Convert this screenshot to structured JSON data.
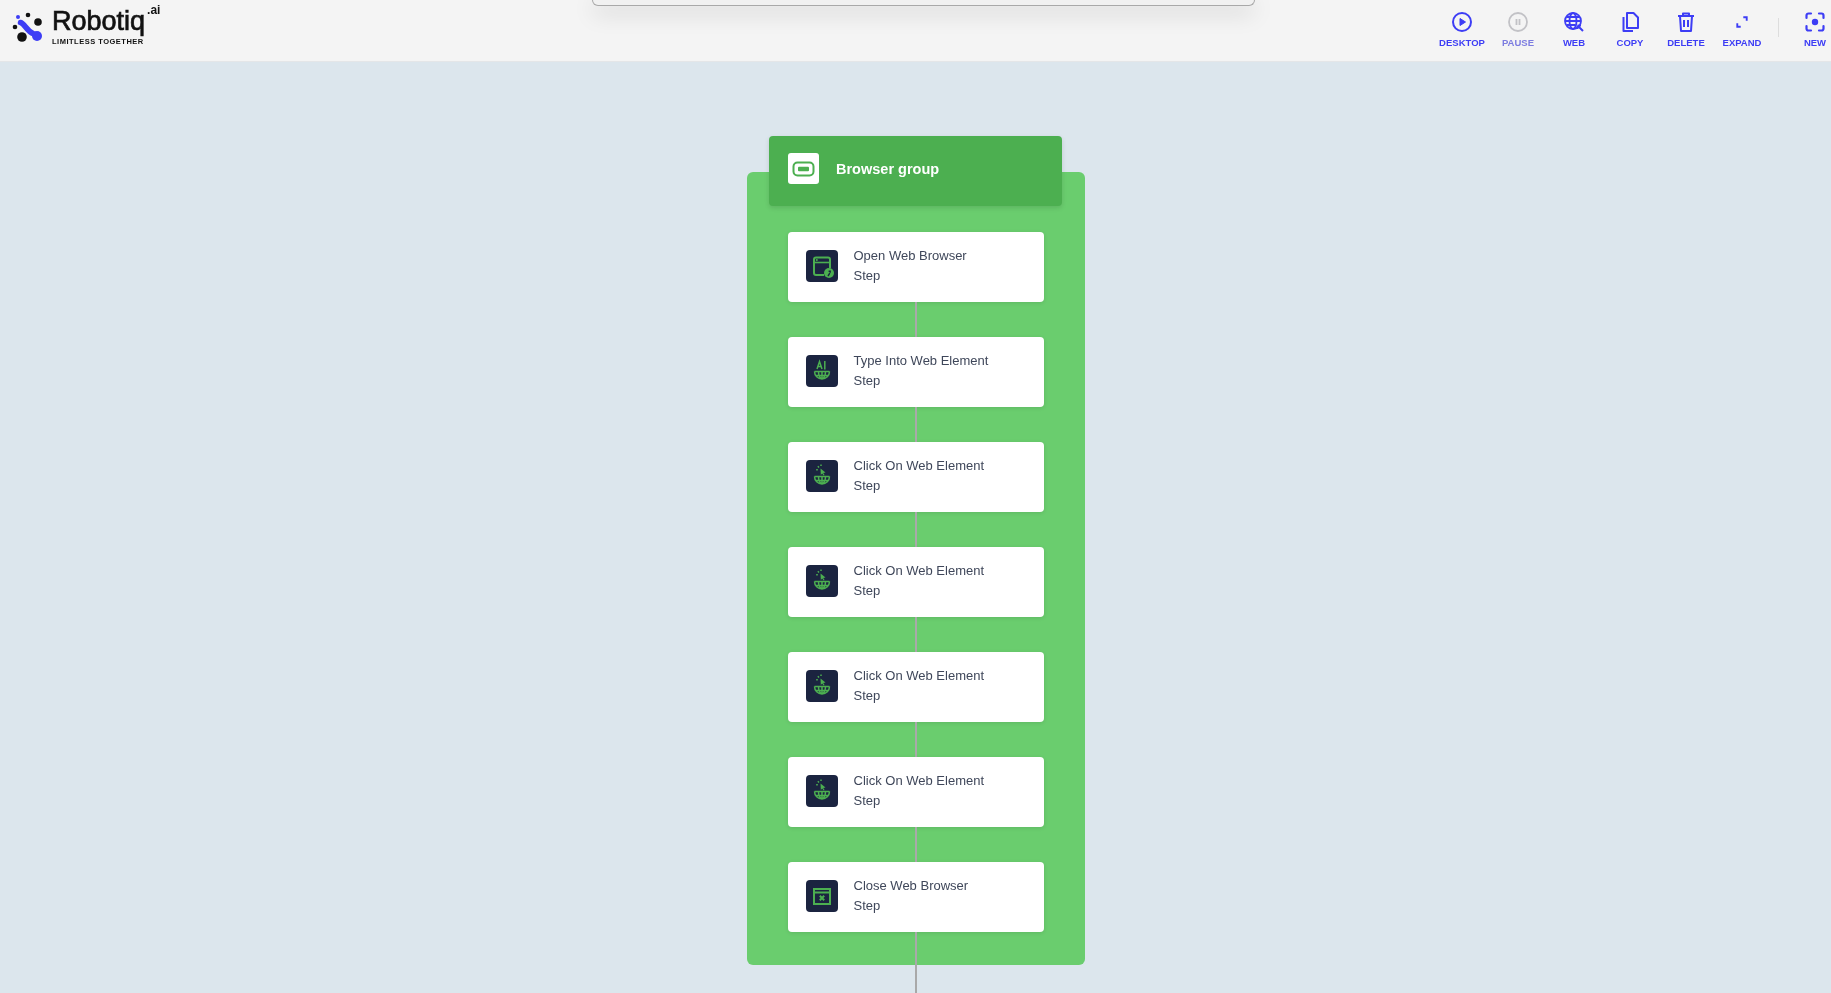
{
  "header": {
    "logo": {
      "wordmark": "Robotiq",
      "superscript": ".ai",
      "tagline": "LIMITLESS TOGETHER"
    },
    "toolbar": [
      {
        "label": "DESKTOP",
        "kind": "desktop",
        "disabled": false
      },
      {
        "label": "PAUSE",
        "kind": "pause",
        "disabled": true
      },
      {
        "label": "WEB",
        "kind": "web",
        "disabled": false
      },
      {
        "label": "COPY",
        "kind": "copy",
        "disabled": false
      },
      {
        "label": "DELETE",
        "kind": "delete",
        "disabled": false
      },
      {
        "label": "EXPAND",
        "kind": "expand",
        "disabled": false
      }
    ],
    "toolbar_end": [
      {
        "label": "NEW",
        "kind": "new",
        "disabled": false
      }
    ]
  },
  "canvas": {
    "group": {
      "title": "Browser group",
      "steps": [
        {
          "title": "Open Web Browser",
          "subtitle": "Step",
          "kind": "open"
        },
        {
          "title": "Type Into Web Element",
          "subtitle": "Step",
          "kind": "type"
        },
        {
          "title": "Click On Web Element",
          "subtitle": "Step",
          "kind": "click"
        },
        {
          "title": "Click On Web Element",
          "subtitle": "Step",
          "kind": "click"
        },
        {
          "title": "Click On Web Element",
          "subtitle": "Step",
          "kind": "click"
        },
        {
          "title": "Click On Web Element",
          "subtitle": "Step",
          "kind": "click"
        },
        {
          "title": "Close Web Browser",
          "subtitle": "Step",
          "kind": "close"
        }
      ]
    }
  }
}
